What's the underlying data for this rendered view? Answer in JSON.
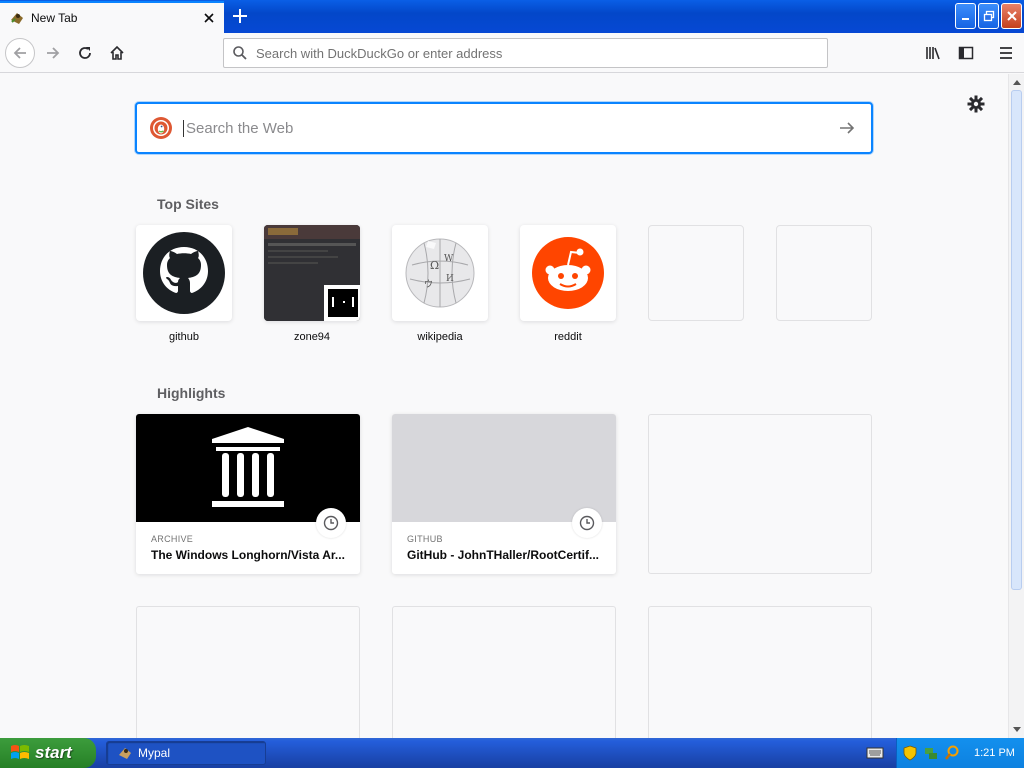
{
  "window": {
    "tab_title": "New Tab"
  },
  "navbar": {
    "url_placeholder": "Search with DuckDuckGo or enter address"
  },
  "newtab": {
    "search_placeholder": "Search the Web",
    "top_sites_title": "Top Sites",
    "highlights_title": "Highlights",
    "top_sites": [
      {
        "label": "github"
      },
      {
        "label": "zone94"
      },
      {
        "label": "wikipedia"
      },
      {
        "label": "reddit"
      }
    ],
    "highlights": [
      {
        "source": "ARCHIVE",
        "title": "The Windows Longhorn/Vista Ar..."
      },
      {
        "source": "GITHUB",
        "title": "GitHub - JohnTHaller/RootCertif..."
      }
    ]
  },
  "taskbar": {
    "start_label": "start",
    "task_label": "Mypal",
    "clock": "1:21 PM"
  },
  "colors": {
    "accent": "#0a84ff",
    "reddit": "#ff4500",
    "taskbar": "#245edb",
    "start": "#2f8c2f"
  }
}
